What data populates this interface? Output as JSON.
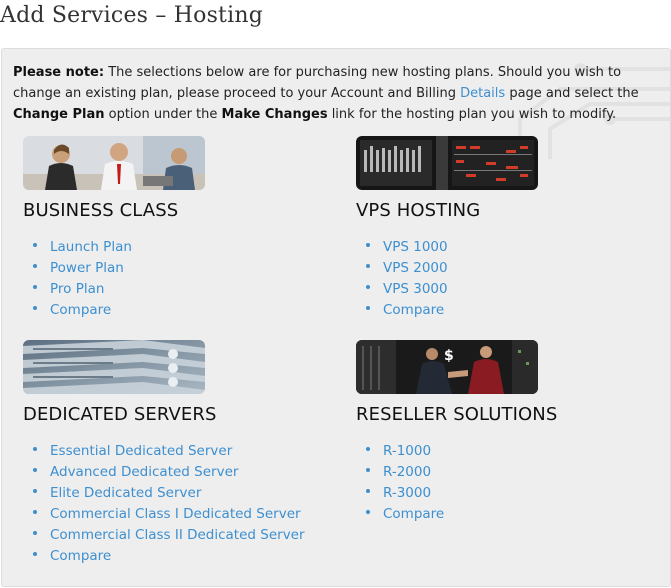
{
  "page": {
    "title": "Add Services – Hosting"
  },
  "note": {
    "label": "Please note:",
    "text1": " The selections below are for purchasing new hosting plans. Should you wish to change an existing plan, please proceed to your Account and Billing ",
    "details_link": "Details",
    "text2": " page and select the ",
    "change_plan": "Change Plan",
    "text3": " option under the ",
    "make_changes": "Make Changes",
    "text4": " link for the hosting plan you wish to modify."
  },
  "sections": [
    {
      "title": "BUSINESS CLASS",
      "image": "business-people-photo",
      "links": [
        "Launch Plan",
        "Power Plan",
        "Pro Plan",
        "Compare"
      ]
    },
    {
      "title": "VPS HOSTING",
      "image": "server-rack-photo",
      "links": [
        "VPS 1000",
        "VPS 2000",
        "VPS 3000",
        "Compare"
      ]
    },
    {
      "title": "DEDICATED SERVERS",
      "image": "server-stack-photo",
      "links": [
        "Essential Dedicated Server",
        "Advanced Dedicated Server",
        "Elite Dedicated Server",
        "Commercial Class I Dedicated Server",
        "Commercial Class II Dedicated Server",
        "Compare"
      ]
    },
    {
      "title": "RESELLER SOLUTIONS",
      "image": "handshake-photo",
      "links": [
        "R-1000",
        "R-2000",
        "R-3000",
        "Compare"
      ]
    }
  ],
  "colors": {
    "link": "#3d8fd0",
    "panel_bg": "#eeeeee",
    "title": "#333333"
  }
}
